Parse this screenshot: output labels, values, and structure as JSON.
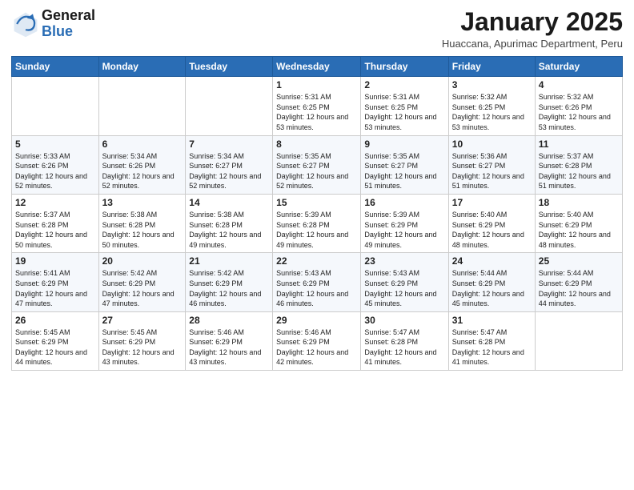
{
  "header": {
    "logo_line1": "General",
    "logo_line2": "Blue",
    "month_title": "January 2025",
    "subtitle": "Huaccana, Apurimac Department, Peru"
  },
  "days_of_week": [
    "Sunday",
    "Monday",
    "Tuesday",
    "Wednesday",
    "Thursday",
    "Friday",
    "Saturday"
  ],
  "weeks": [
    [
      {
        "day": "",
        "sunrise": "",
        "sunset": "",
        "daylight": ""
      },
      {
        "day": "",
        "sunrise": "",
        "sunset": "",
        "daylight": ""
      },
      {
        "day": "",
        "sunrise": "",
        "sunset": "",
        "daylight": ""
      },
      {
        "day": "1",
        "sunrise": "Sunrise: 5:31 AM",
        "sunset": "Sunset: 6:25 PM",
        "daylight": "Daylight: 12 hours and 53 minutes."
      },
      {
        "day": "2",
        "sunrise": "Sunrise: 5:31 AM",
        "sunset": "Sunset: 6:25 PM",
        "daylight": "Daylight: 12 hours and 53 minutes."
      },
      {
        "day": "3",
        "sunrise": "Sunrise: 5:32 AM",
        "sunset": "Sunset: 6:25 PM",
        "daylight": "Daylight: 12 hours and 53 minutes."
      },
      {
        "day": "4",
        "sunrise": "Sunrise: 5:32 AM",
        "sunset": "Sunset: 6:26 PM",
        "daylight": "Daylight: 12 hours and 53 minutes."
      }
    ],
    [
      {
        "day": "5",
        "sunrise": "Sunrise: 5:33 AM",
        "sunset": "Sunset: 6:26 PM",
        "daylight": "Daylight: 12 hours and 52 minutes."
      },
      {
        "day": "6",
        "sunrise": "Sunrise: 5:34 AM",
        "sunset": "Sunset: 6:26 PM",
        "daylight": "Daylight: 12 hours and 52 minutes."
      },
      {
        "day": "7",
        "sunrise": "Sunrise: 5:34 AM",
        "sunset": "Sunset: 6:27 PM",
        "daylight": "Daylight: 12 hours and 52 minutes."
      },
      {
        "day": "8",
        "sunrise": "Sunrise: 5:35 AM",
        "sunset": "Sunset: 6:27 PM",
        "daylight": "Daylight: 12 hours and 52 minutes."
      },
      {
        "day": "9",
        "sunrise": "Sunrise: 5:35 AM",
        "sunset": "Sunset: 6:27 PM",
        "daylight": "Daylight: 12 hours and 51 minutes."
      },
      {
        "day": "10",
        "sunrise": "Sunrise: 5:36 AM",
        "sunset": "Sunset: 6:27 PM",
        "daylight": "Daylight: 12 hours and 51 minutes."
      },
      {
        "day": "11",
        "sunrise": "Sunrise: 5:37 AM",
        "sunset": "Sunset: 6:28 PM",
        "daylight": "Daylight: 12 hours and 51 minutes."
      }
    ],
    [
      {
        "day": "12",
        "sunrise": "Sunrise: 5:37 AM",
        "sunset": "Sunset: 6:28 PM",
        "daylight": "Daylight: 12 hours and 50 minutes."
      },
      {
        "day": "13",
        "sunrise": "Sunrise: 5:38 AM",
        "sunset": "Sunset: 6:28 PM",
        "daylight": "Daylight: 12 hours and 50 minutes."
      },
      {
        "day": "14",
        "sunrise": "Sunrise: 5:38 AM",
        "sunset": "Sunset: 6:28 PM",
        "daylight": "Daylight: 12 hours and 49 minutes."
      },
      {
        "day": "15",
        "sunrise": "Sunrise: 5:39 AM",
        "sunset": "Sunset: 6:28 PM",
        "daylight": "Daylight: 12 hours and 49 minutes."
      },
      {
        "day": "16",
        "sunrise": "Sunrise: 5:39 AM",
        "sunset": "Sunset: 6:29 PM",
        "daylight": "Daylight: 12 hours and 49 minutes."
      },
      {
        "day": "17",
        "sunrise": "Sunrise: 5:40 AM",
        "sunset": "Sunset: 6:29 PM",
        "daylight": "Daylight: 12 hours and 48 minutes."
      },
      {
        "day": "18",
        "sunrise": "Sunrise: 5:40 AM",
        "sunset": "Sunset: 6:29 PM",
        "daylight": "Daylight: 12 hours and 48 minutes."
      }
    ],
    [
      {
        "day": "19",
        "sunrise": "Sunrise: 5:41 AM",
        "sunset": "Sunset: 6:29 PM",
        "daylight": "Daylight: 12 hours and 47 minutes."
      },
      {
        "day": "20",
        "sunrise": "Sunrise: 5:42 AM",
        "sunset": "Sunset: 6:29 PM",
        "daylight": "Daylight: 12 hours and 47 minutes."
      },
      {
        "day": "21",
        "sunrise": "Sunrise: 5:42 AM",
        "sunset": "Sunset: 6:29 PM",
        "daylight": "Daylight: 12 hours and 46 minutes."
      },
      {
        "day": "22",
        "sunrise": "Sunrise: 5:43 AM",
        "sunset": "Sunset: 6:29 PM",
        "daylight": "Daylight: 12 hours and 46 minutes."
      },
      {
        "day": "23",
        "sunrise": "Sunrise: 5:43 AM",
        "sunset": "Sunset: 6:29 PM",
        "daylight": "Daylight: 12 hours and 45 minutes."
      },
      {
        "day": "24",
        "sunrise": "Sunrise: 5:44 AM",
        "sunset": "Sunset: 6:29 PM",
        "daylight": "Daylight: 12 hours and 45 minutes."
      },
      {
        "day": "25",
        "sunrise": "Sunrise: 5:44 AM",
        "sunset": "Sunset: 6:29 PM",
        "daylight": "Daylight: 12 hours and 44 minutes."
      }
    ],
    [
      {
        "day": "26",
        "sunrise": "Sunrise: 5:45 AM",
        "sunset": "Sunset: 6:29 PM",
        "daylight": "Daylight: 12 hours and 44 minutes."
      },
      {
        "day": "27",
        "sunrise": "Sunrise: 5:45 AM",
        "sunset": "Sunset: 6:29 PM",
        "daylight": "Daylight: 12 hours and 43 minutes."
      },
      {
        "day": "28",
        "sunrise": "Sunrise: 5:46 AM",
        "sunset": "Sunset: 6:29 PM",
        "daylight": "Daylight: 12 hours and 43 minutes."
      },
      {
        "day": "29",
        "sunrise": "Sunrise: 5:46 AM",
        "sunset": "Sunset: 6:29 PM",
        "daylight": "Daylight: 12 hours and 42 minutes."
      },
      {
        "day": "30",
        "sunrise": "Sunrise: 5:47 AM",
        "sunset": "Sunset: 6:28 PM",
        "daylight": "Daylight: 12 hours and 41 minutes."
      },
      {
        "day": "31",
        "sunrise": "Sunrise: 5:47 AM",
        "sunset": "Sunset: 6:28 PM",
        "daylight": "Daylight: 12 hours and 41 minutes."
      },
      {
        "day": "",
        "sunrise": "",
        "sunset": "",
        "daylight": ""
      }
    ]
  ]
}
